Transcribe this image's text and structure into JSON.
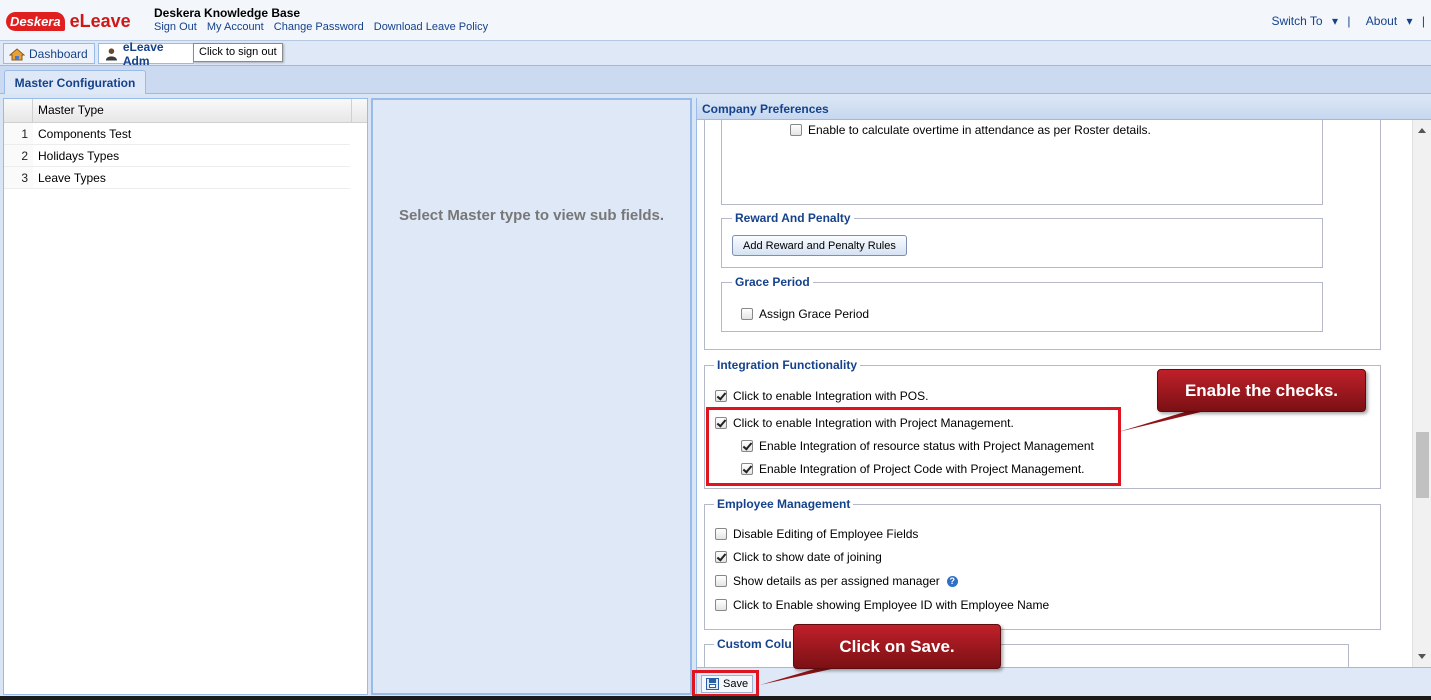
{
  "header": {
    "logo_brand": "Deskera",
    "logo_app": "eLeave",
    "title": "Deskera Knowledge Base",
    "links": [
      "Sign Out",
      "My Account",
      "Change Password",
      "Download Leave Policy"
    ],
    "switch_to": "Switch To",
    "about": "About",
    "separator": "|"
  },
  "nav": {
    "dashboard": "Dashboard",
    "admin_tab": "eLeave Adm",
    "tooltip": "Click to sign out"
  },
  "master_tab": "Master Configuration",
  "grid": {
    "column_header": "Master Type",
    "rows": [
      {
        "num": "1",
        "label": "Components Test"
      },
      {
        "num": "2",
        "label": "Holidays Types"
      },
      {
        "num": "3",
        "label": "Leave Types"
      }
    ]
  },
  "middle": {
    "message": "Select Master type to view sub fields."
  },
  "preferences": {
    "title": "Company Preferences",
    "overtime_label": "Enable to calculate overtime in attendance as per Roster details.",
    "overtime_checked": false,
    "reward": {
      "legend": "Reward And Penalty",
      "button": "Add Reward and Penalty Rules"
    },
    "grace": {
      "legend": "Grace Period",
      "label": "Assign Grace Period",
      "checked": false
    },
    "integration": {
      "legend": "Integration Functionality",
      "pos": "Click to enable Integration with POS.",
      "pm": "Click to enable Integration with Project Management.",
      "resource": "Enable Integration of resource status with Project Management",
      "project_code": "Enable Integration of Project Code with Project Management."
    },
    "employee": {
      "legend": "Employee Management",
      "disable_editing": "Disable Editing of Employee Fields",
      "date_of_joining": "Click to show date of joining",
      "assigned_manager": "Show details as per assigned manager",
      "employee_id": "Click to Enable showing Employee ID with Employee Name"
    },
    "custom_columns_legend": "Custom Colu",
    "save": "Save"
  },
  "annotations": {
    "enable_checks": "Enable the checks.",
    "click_save": "Click on Save.",
    "accent_color": "#e0141e"
  }
}
